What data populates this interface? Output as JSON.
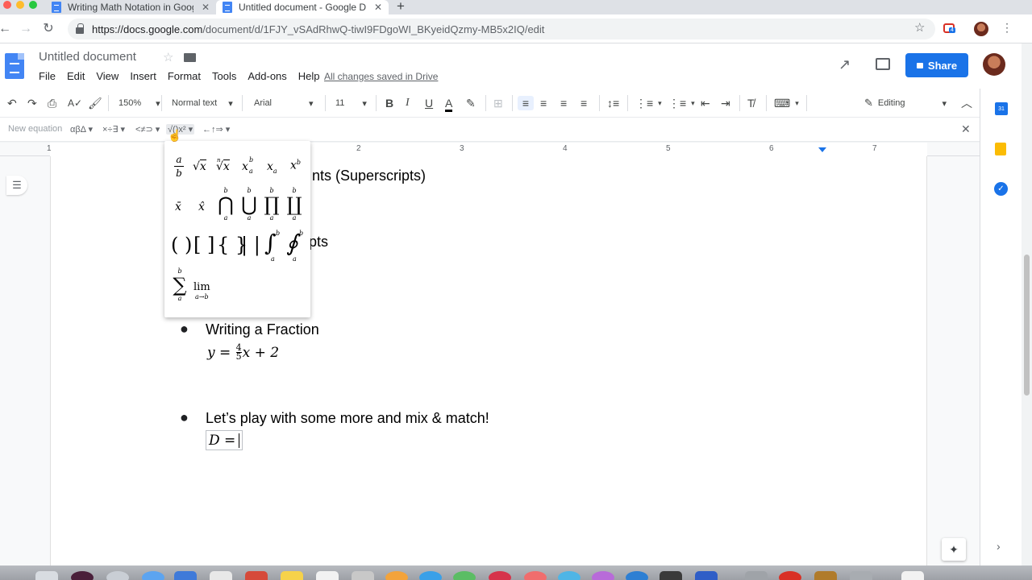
{
  "browser": {
    "tabs": [
      {
        "title": "Writing Math Notation in Goog",
        "close": "✕"
      },
      {
        "title": "Untitled document - Google Do",
        "close": "✕"
      }
    ],
    "new_tab": "+",
    "url_host": "https://docs.google.com",
    "url_path": "/document/d/1FJY_vSAdRhwQ-tiwI9FDgoWI_BKyeidQzmy-MB5x2IQ/edit",
    "extension_badge": "4"
  },
  "docs": {
    "title": "Untitled document",
    "menu": [
      "File",
      "Edit",
      "View",
      "Insert",
      "Format",
      "Tools",
      "Add-ons",
      "Help"
    ],
    "saved_status": "All changes saved in Drive",
    "share_label": "Share"
  },
  "toolbar": {
    "zoom": "150%",
    "style": "Normal text",
    "font": "Arial",
    "font_size": "11",
    "bold": "B",
    "italic": "I",
    "underline": "U",
    "text_color": "A",
    "mode": "Editing"
  },
  "equation_bar": {
    "new_equation": "New equation",
    "greek": "αβΔ",
    "operators": "×÷∃",
    "relations": "<≠⊃",
    "math_ops": "√()x²",
    "arrows": "←↑⇒",
    "close": "✕"
  },
  "ruler": {
    "marks": [
      "1",
      "1",
      "2",
      "3",
      "4",
      "5",
      "6",
      "7"
    ]
  },
  "document": {
    "line1": "nts (Superscripts)",
    "line2": "pts",
    "fraction_heading": "Writing a Fraction",
    "fraction_eq_lhs": "y = ",
    "fraction_num": "4",
    "fraction_den": "5",
    "fraction_eq_rhs": "x + 2",
    "mix_heading": "Let’s play with some more and mix & match!",
    "mix_eq": "D ="
  },
  "popup": {
    "frac_num": "a",
    "frac_den": "b",
    "sqrt_var": "x",
    "nthroot_var": "x",
    "nthroot_index": "n",
    "supsub_base": "x",
    "supsub_sup": "b",
    "supsub_sub": "a",
    "sub_base": "x",
    "sub_sub": "a",
    "sup_base": "x",
    "sup_sup": "b",
    "bar_var": "x̄",
    "hat_var": "x̂",
    "op_upper": "b",
    "op_lower": "a",
    "cap": "⋂",
    "cup": "⋃",
    "prod": "∏",
    "coprod": "∐",
    "parens": "( )",
    "brackets": "[ ]",
    "braces": "{ }",
    "bars": "| |",
    "integral": "∫",
    "contour": "∮",
    "sum": "∑",
    "lim": "lim",
    "lim_sub": "a→b"
  },
  "colors": {
    "accent": "#1a73e8",
    "docs_blue": "#4285f4",
    "keep_yellow": "#fbbc04"
  }
}
